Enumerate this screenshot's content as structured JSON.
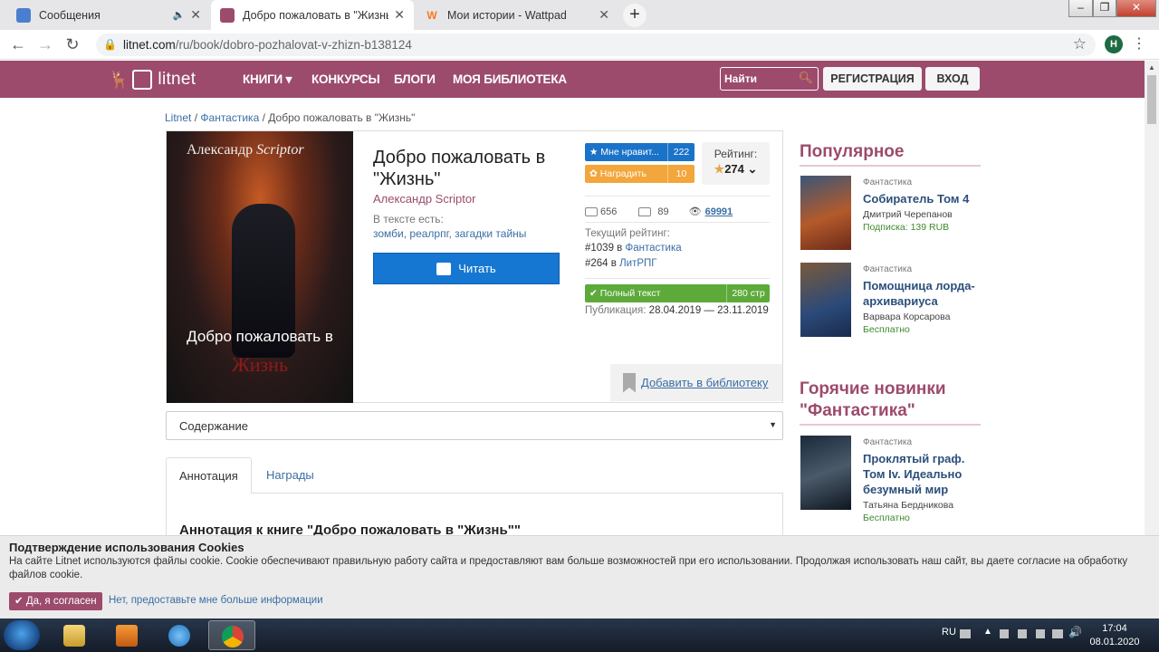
{
  "browser": {
    "tabs": [
      {
        "title": "Сообщения",
        "active": false
      },
      {
        "title": "Добро пожаловать в \"Жизнь\" ",
        "active": true
      },
      {
        "title": "Мои истории - Wattpad",
        "active": false
      }
    ],
    "new_tab": "+",
    "window_buttons": {
      "minimize": "–",
      "maximize": "❐",
      "close": "✕"
    },
    "url_host": "litnet.com",
    "url_path": "/ru/book/dobro-pozhalovat-v-zhizn-b138124",
    "profile_initial": "H"
  },
  "header": {
    "logo": "litnet",
    "nav": [
      "КНИГИ",
      "КОНКУРСЫ",
      "БЛОГИ",
      "МОЯ БИБЛИОТЕКА"
    ],
    "books_caret": "▾",
    "search_placeholder": "Найти",
    "register": "РЕГИСТРАЦИЯ",
    "login": "ВХОД",
    "brand_color": "#9c4b6c"
  },
  "breadcrumb": {
    "items": [
      "Litnet",
      "Фантастика"
    ],
    "current": "Добро пожаловать в \"Жизнь\"",
    "sep": "/"
  },
  "book": {
    "cover_author_plain": "Александр ",
    "cover_author_italic": "Scriptor",
    "cover_title_1": "Добро пожаловать в",
    "cover_title_2": "Жизнь",
    "title": "Добро пожаловать в \"Жизнь\"",
    "author": "Александр Scriptor",
    "in_text_label": "В тексте есть:",
    "tags": "зомби, реалрпг, загадки тайны",
    "read_button": "Читать",
    "like_label": "Мне нравит...",
    "like_count": "222",
    "reward_label": "Наградить",
    "reward_count": "10",
    "rating_label": "Рейтинг:",
    "rating_value": "274",
    "rating_star": "★",
    "rating_caret": "⌄",
    "stat_library": "656",
    "stat_comments": "89",
    "stat_views": "69991",
    "current_rating_label": "Текущий рейтинг:",
    "rank1_num": "#1039 в ",
    "rank1_genre": "Фантастика",
    "rank2_num": "#264 в ",
    "rank2_genre": "ЛитРПГ",
    "full_text_label": "Полный текст",
    "pages": "280 стр",
    "publication_label": "Публикация: ",
    "publication_dates": "28.04.2019 — 23.11.2019",
    "add_to_library": "Добавить в библиотеку"
  },
  "contents": {
    "label": "Содержание",
    "caret": "▼"
  },
  "tabs": {
    "annotation": "Аннотация",
    "awards": "Награды"
  },
  "annotation_heading": "Аннотация к книге \"Добро пожаловать в \"Жизнь\"\"",
  "sidebar": {
    "popular_heading": "Популярное",
    "popular": [
      {
        "category": "Фантастика",
        "title": "Собиратель Том 4",
        "author": "Дмитрий Черепанов",
        "price": "Подписка: 139 RUB"
      },
      {
        "category": "Фантастика",
        "title": "Помощница лорда-архивариуса",
        "author": "Варвара Корсарова",
        "price": "Бесплатно"
      }
    ],
    "hot_heading_1": "Горячие новинки",
    "hot_heading_2": "\"Фантастика\"",
    "hot": [
      {
        "category": "Фантастика",
        "title": "Проклятый граф. Том Iv. Идеально безумный мир",
        "author": "Татьяна Бердникова",
        "price": "Бесплатно"
      }
    ]
  },
  "cookie": {
    "heading": "Подтверждение использования Cookies",
    "text": "На сайте Litnet используются файлы cookie. Cookie обеспечивают правильную работу сайта и предоставляют вам больше возможностей при его использовании. Продолжая использовать наш сайт, вы даете согласие на обработку файлов cookie.",
    "agree": "✔ Да, я согласен",
    "more": "Нет, предоставьте мне больше информации"
  },
  "taskbar": {
    "lang": "RU",
    "time": "17:04",
    "date": "08.01.2020"
  }
}
